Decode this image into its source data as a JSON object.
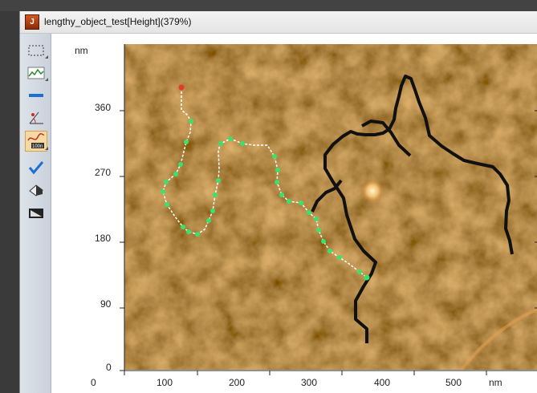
{
  "window": {
    "title": "lengthy_object_test[Height](379%)"
  },
  "toolbar": {
    "tools": [
      {
        "name": "select-rect-tool",
        "icon": "dashed-rectangle-icon"
      },
      {
        "name": "profile-tool",
        "icon": "landscape-profile-icon"
      },
      {
        "name": "line-measure-tool",
        "icon": "blue-bar-icon"
      },
      {
        "name": "angle-tool",
        "icon": "angle-measure-icon"
      },
      {
        "name": "length-tool",
        "icon": "curve-length-icon",
        "active": true,
        "badge": "100n"
      },
      {
        "name": "check-tool",
        "icon": "checkmark-icon"
      },
      {
        "name": "eraser-tool",
        "icon": "eraser-icon"
      },
      {
        "name": "mask-tool",
        "icon": "mask-icon"
      }
    ]
  },
  "axes": {
    "y_unit": "nm",
    "x_unit": "nm",
    "y_ticks": [
      "360",
      "270",
      "180",
      "90",
      "0"
    ],
    "x_ticks": [
      "0",
      "100",
      "200",
      "300",
      "400",
      "500"
    ],
    "x_range": [
      0,
      570
    ],
    "y_range": [
      0,
      445
    ]
  },
  "colors": {
    "background": "#b26020",
    "trace": "#111111",
    "marker": "#39e36a",
    "start_marker": "#e23b2b",
    "bright_spot": "#ffe4a0"
  }
}
